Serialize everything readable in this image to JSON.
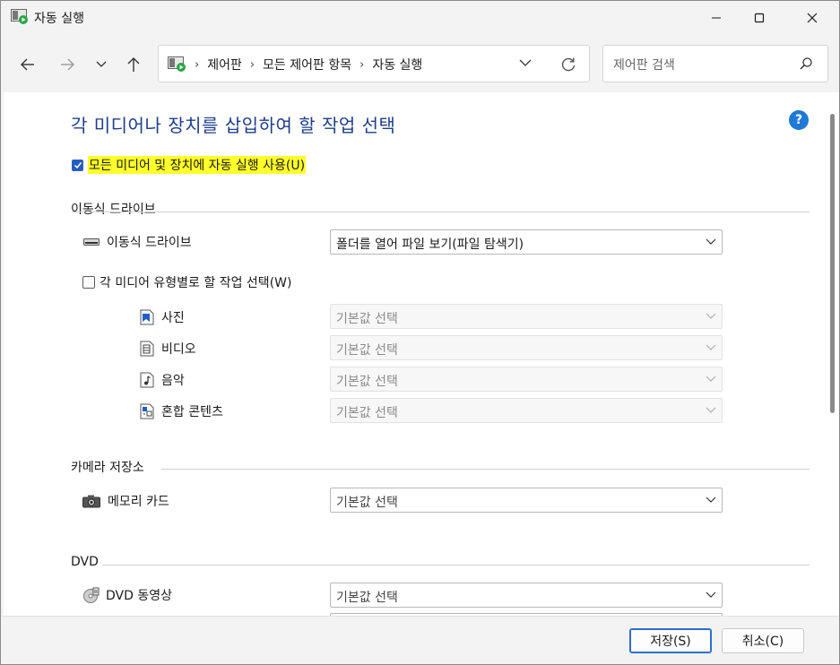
{
  "window": {
    "title": "자동 실행",
    "minimize_icon": "minimize-icon",
    "maximize_icon": "maximize-icon",
    "close_icon": "close-icon"
  },
  "nav": {
    "breadcrumbs": [
      "제어판",
      "모든 제어판 항목",
      "자동 실행"
    ],
    "search_placeholder": "제어판 검색"
  },
  "main": {
    "heading": "각 미디어나 장치를 삽입하여 할 작업 선택",
    "master_checkbox": {
      "label": "모든 미디어 및 장치에 자동 실행 사용(U)",
      "checked": true
    },
    "sections": {
      "removable": {
        "title": "이동식 드라이브",
        "drive_label": "이동식 드라이브",
        "drive_value": "폴더를 열어 파일 보기(파일 탐색기)",
        "per_type_checkbox": {
          "label": "각 미디어 유형별로 할 작업 선택(W)",
          "checked": false
        },
        "media": [
          {
            "label": "사진",
            "value": "기본값 선택",
            "icon": "photo-file-icon"
          },
          {
            "label": "비디오",
            "value": "기본값 선택",
            "icon": "video-file-icon"
          },
          {
            "label": "음악",
            "value": "기본값 선택",
            "icon": "music-file-icon"
          },
          {
            "label": "혼합 콘텐츠",
            "value": "기본값 선택",
            "icon": "mixed-content-icon"
          }
        ]
      },
      "camera": {
        "title": "카메라 저장소",
        "card_label": "메모리 카드",
        "card_value": "기본값 선택"
      },
      "dvd": {
        "title": "DVD",
        "movie_label": "DVD 동영상",
        "movie_value": "기본값 선택"
      }
    }
  },
  "footer": {
    "save_label": "저장(S)",
    "cancel_label": "취소(C)"
  },
  "colors": {
    "accent": "#1f5fc4",
    "heading": "#1e3e8a",
    "highlight": "#ffff2a"
  }
}
